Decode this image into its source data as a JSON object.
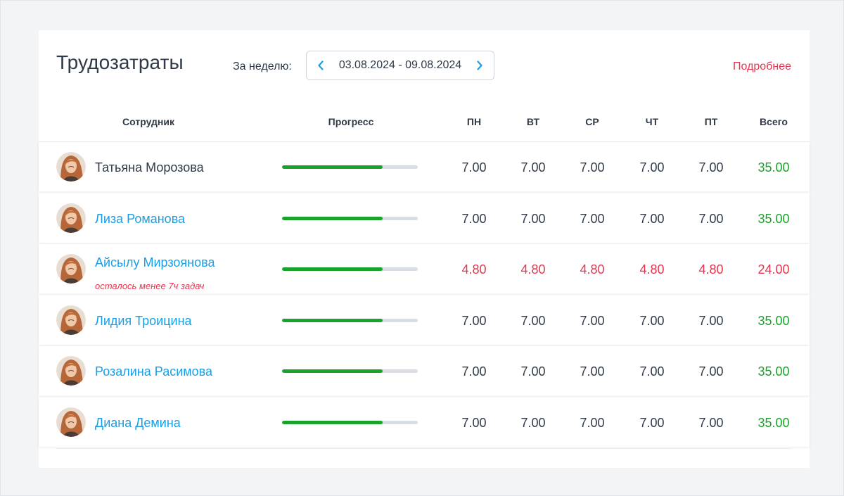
{
  "header": {
    "title": "Трудозатраты",
    "week_label": "За неделю:",
    "date_range": "03.08.2024 - 09.08.2024",
    "more_link": "Подробнее"
  },
  "columns": {
    "employee": "Сотрудник",
    "progress": "Прогресс",
    "mon": "ПН",
    "tue": "ВТ",
    "wed": "СР",
    "thu": "ЧТ",
    "fri": "ПТ",
    "total": "Всего"
  },
  "colors": {
    "link": "#1a9ee6",
    "danger": "#e8344e",
    "success": "#1aa32a",
    "accent_chevron": "#1a9ee6"
  },
  "rows": [
    {
      "name": "Татьяна Морозова",
      "note": "",
      "progress": 0.74,
      "mon": "7.00",
      "tue": "7.00",
      "wed": "7.00",
      "thu": "7.00",
      "fri": "7.00",
      "total": "35.00"
    },
    {
      "name": "Лиза Романова",
      "note": "",
      "progress": 0.74,
      "mon": "7.00",
      "tue": "7.00",
      "wed": "7.00",
      "thu": "7.00",
      "fri": "7.00",
      "total": "35.00"
    },
    {
      "name": "Айсылу Мирзоянова",
      "note": "осталось менее 7ч задач",
      "progress": 0.74,
      "mon": "4.80",
      "tue": "4.80",
      "wed": "4.80",
      "thu": "4.80",
      "fri": "4.80",
      "total": "24.00"
    },
    {
      "name": "Лидия Троицина",
      "note": "",
      "progress": 0.74,
      "mon": "7.00",
      "tue": "7.00",
      "wed": "7.00",
      "thu": "7.00",
      "fri": "7.00",
      "total": "35.00"
    },
    {
      "name": "Розалина Расимова",
      "note": "",
      "progress": 0.74,
      "mon": "7.00",
      "tue": "7.00",
      "wed": "7.00",
      "thu": "7.00",
      "fri": "7.00",
      "total": "35.00"
    },
    {
      "name": "Диана Демина",
      "note": "",
      "progress": 0.74,
      "mon": "7.00",
      "tue": "7.00",
      "wed": "7.00",
      "thu": "7.00",
      "fri": "7.00",
      "total": "35.00"
    }
  ]
}
